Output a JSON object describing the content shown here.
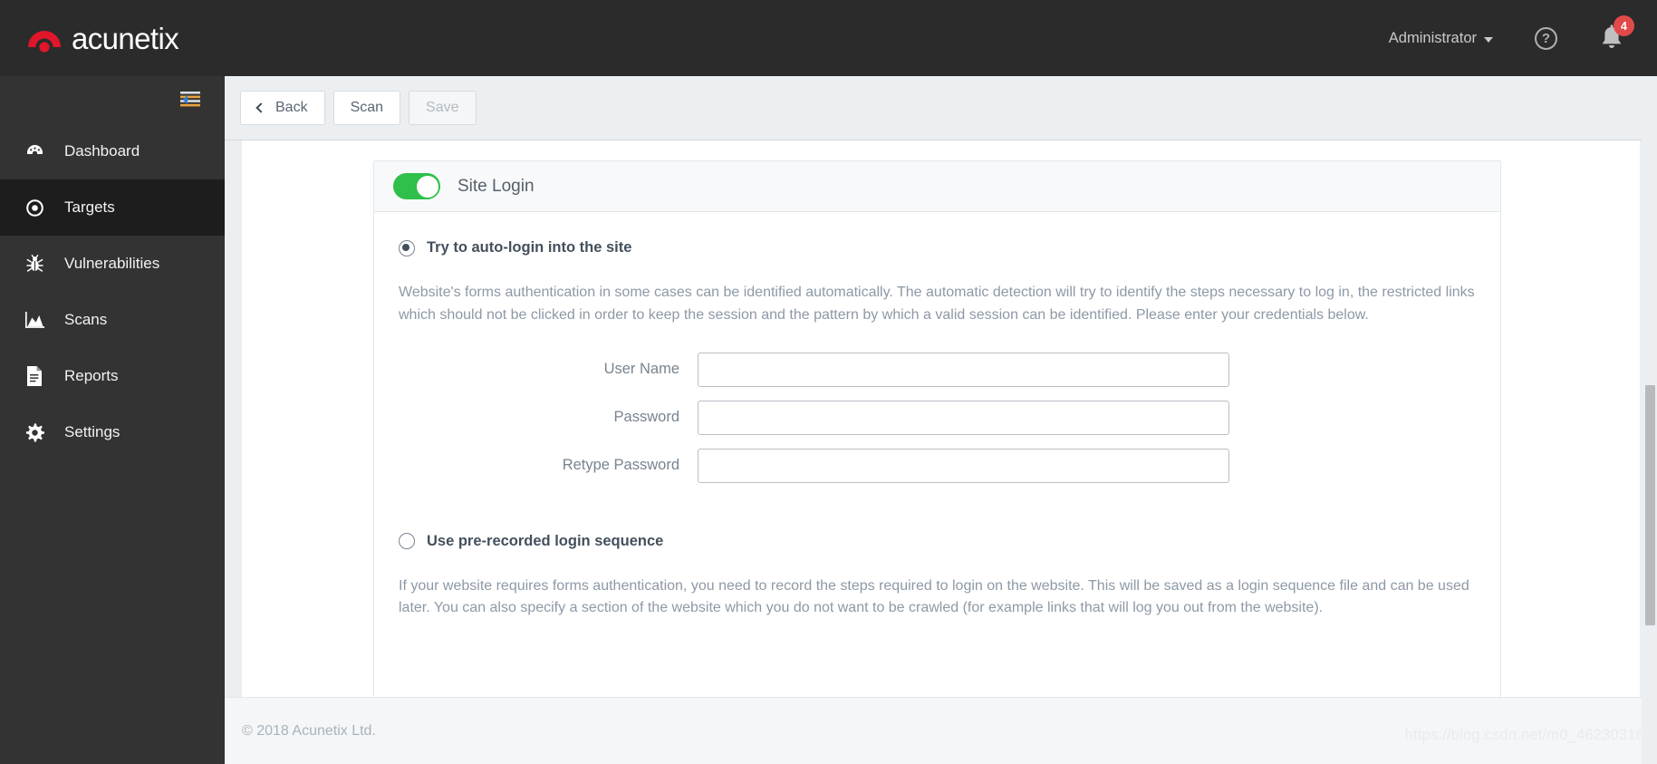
{
  "app": {
    "brand_name": "acunetix",
    "brand_color": "#e0162b"
  },
  "header": {
    "user_menu_label": "Administrator",
    "help_icon": "question-mark-circle-icon",
    "notifications_icon": "bell-icon",
    "notifications_count": "4",
    "badge_color": "#e24a4a"
  },
  "sidebar": {
    "collapse_icon": "collapse-sidebar-icon",
    "items": [
      {
        "label": "Dashboard",
        "icon": "dashboard-gauge-icon",
        "active": false
      },
      {
        "label": "Targets",
        "icon": "target-circle-icon",
        "active": true
      },
      {
        "label": "Vulnerabilities",
        "icon": "bug-icon",
        "active": false
      },
      {
        "label": "Scans",
        "icon": "chart-area-icon",
        "active": false
      },
      {
        "label": "Reports",
        "icon": "document-icon",
        "active": false
      },
      {
        "label": "Settings",
        "icon": "gear-icon",
        "active": false
      }
    ]
  },
  "toolbar": {
    "back_label": "Back",
    "back_icon": "chevron-left-icon",
    "scan_label": "Scan",
    "save_label": "Save",
    "save_disabled": true
  },
  "card": {
    "toggle_label": "Site Login",
    "toggle_on": true,
    "toggle_on_color": "#2ec04a",
    "options": [
      {
        "label": "Try to auto-login into the site",
        "selected": true,
        "description": "Website's forms authentication in some cases can be identified automatically. The automatic detection will try to identify the steps necessary to log in, the restricted links which should not be clicked in order to keep the session and the pattern by which a valid session can be identified. Please enter your credentials below."
      },
      {
        "label": "Use pre-recorded login sequence",
        "selected": false,
        "description": "If your website requires forms authentication, you need to record the steps required to login on the website. This will be saved as a login sequence file and can be used later. You can also specify a section of the website which you do not want to be crawled (for example links that will log you out from the website)."
      }
    ],
    "form": {
      "fields": [
        {
          "label": "User Name",
          "value": "",
          "placeholder": "",
          "type": "text"
        },
        {
          "label": "Password",
          "value": "",
          "placeholder": "",
          "type": "password"
        },
        {
          "label": "Retype Password",
          "value": "",
          "placeholder": "",
          "type": "password"
        }
      ]
    }
  },
  "footer": {
    "copyright": "© 2018 Acunetix Ltd.",
    "watermark": "https://blog.csdn.net/m0_46230316"
  }
}
